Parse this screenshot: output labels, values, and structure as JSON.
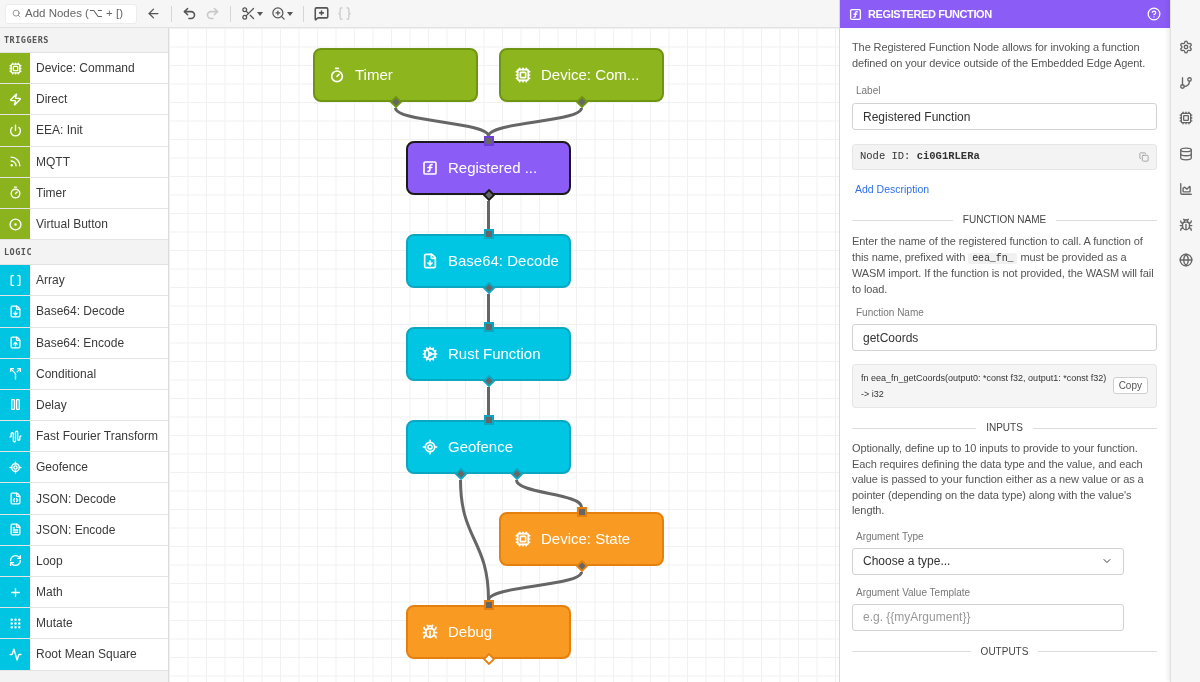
{
  "toolbar": {
    "search": {
      "placeholder": "Add Nodes (⌥ + [)"
    },
    "groups": [
      {
        "buttons": [
          {
            "kind": "back",
            "disabled": false
          }
        ]
      },
      {
        "buttons": [
          {
            "kind": "undo",
            "disabled": false
          },
          {
            "kind": "redo",
            "disabled": true
          }
        ]
      },
      {
        "buttons": [
          {
            "kind": "cut",
            "disabled": false
          },
          {
            "kind": "zoom",
            "disabled": false
          }
        ]
      },
      {
        "buttons": [
          {
            "kind": "comment",
            "disabled": false
          },
          {
            "kind": "code",
            "disabled": true
          }
        ]
      }
    ]
  },
  "sidebar": {
    "sections": [
      {
        "title": "TRIGGERS",
        "kind": "trigger",
        "items": [
          "Device: Command",
          "Direct",
          "EEA: Init",
          "MQTT",
          "Timer",
          "Virtual Button"
        ]
      },
      {
        "title": "LOGIC",
        "kind": "logic",
        "items": [
          "Array",
          "Base64: Decode",
          "Base64: Encode",
          "Conditional",
          "Delay",
          "Fast Fourier Transform",
          "Geofence",
          "JSON: Decode",
          "JSON: Encode",
          "Loop",
          "Math",
          "Mutate",
          "Root Mean Square"
        ]
      }
    ]
  },
  "canvas": {
    "nodes": [
      {
        "label": "Timer",
        "kind": "trigger",
        "selected": false,
        "outputs": [
          {
            "connected": true
          }
        ]
      },
      {
        "label": "Device: Com...",
        "kind": "trigger",
        "selected": false,
        "outputs": [
          {
            "connected": true
          }
        ]
      },
      {
        "label": "Registered ...",
        "kind": "function",
        "selected": true,
        "outputs": [
          {
            "connected": true
          }
        ]
      },
      {
        "label": "Base64: Decode",
        "kind": "logic",
        "selected": false,
        "outputs": [
          {
            "connected": true
          }
        ]
      },
      {
        "label": "Rust Function",
        "kind": "logic",
        "selected": false,
        "outputs": [
          {
            "connected": true
          }
        ]
      },
      {
        "label": "Geofence",
        "kind": "logic",
        "selected": false,
        "outputs": [
          {
            "connected": true
          },
          {
            "connected": true
          }
        ]
      },
      {
        "label": "Device: State",
        "kind": "output",
        "selected": false,
        "outputs": [
          {
            "connected": true
          }
        ]
      },
      {
        "label": "Debug",
        "kind": "output",
        "selected": false,
        "outputs": [
          {
            "connected": false
          }
        ]
      }
    ]
  },
  "panel": {
    "title": "REGISTERED FUNCTION",
    "description": "The Registered Function Node allows for invoking a function defined on your device outside of the Embedded Edge Agent.",
    "label_field": {
      "label": "Label",
      "value": "Registered Function"
    },
    "node_id": "Node ID: **ci0G1RLERa**",
    "add_description": "Add Description",
    "function_name_section": {
      "heading": "FUNCTION NAME",
      "text": {
        "before": "Enter the name of the registered function to call. A function of this name, prefixed with",
        "code": "eea_fn_",
        "after": "must be provided as a WASM import. If the function is not provided, the WASM will fail to load."
      },
      "field": {
        "label": "Function Name",
        "value": "getCoords"
      },
      "signature": "fn eea_fn_getCoords(output0: *const f32, output1: *const f32) -> i32",
      "copy_button": "Copy"
    },
    "inputs_section": {
      "heading": "INPUTS",
      "text": "Optionally, define up to 10 inputs to provide to your function. Each requires defining the data type and the value, and each value is passed to your function either as a new value or as a pointer (depending on the data type) along with the value's length.",
      "argument_type": {
        "label": "Argument Type",
        "value": "Choose a type..."
      },
      "argument_value": {
        "label": "Argument Value Template",
        "placeholder": "e.g. {{myArgument}}"
      }
    },
    "outputs_section": {
      "heading": "OUTPUTS"
    }
  }
}
